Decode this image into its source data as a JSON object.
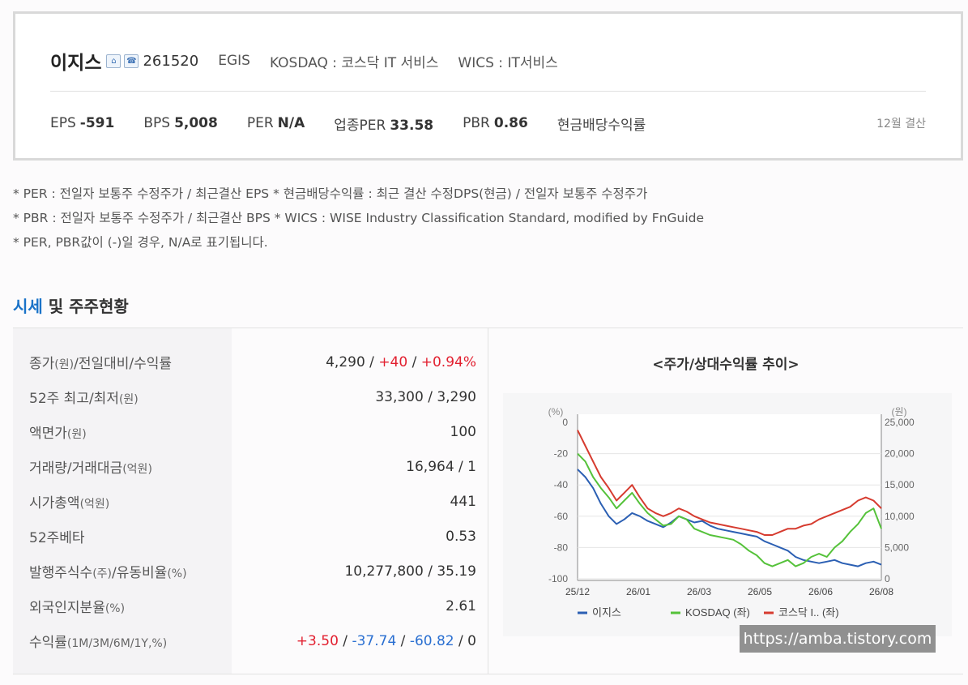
{
  "summary": {
    "company_name": "이지스",
    "home_icon": "home-icon",
    "phone_icon": "phone-icon",
    "code": "261520",
    "english_name": "EGIS",
    "market": "KOSDAQ : 코스닥 IT 서비스",
    "wics": "WICS : IT서비스",
    "indicators": [
      {
        "label": "EPS",
        "value": "-591"
      },
      {
        "label": "BPS",
        "value": "5,008"
      },
      {
        "label": "PER",
        "value": "N/A"
      },
      {
        "label": "업종PER",
        "value": "33.58"
      },
      {
        "label": "PBR",
        "value": "0.86"
      },
      {
        "label": "현금배당수익률",
        "value": ""
      }
    ],
    "settlement": "12월 결산"
  },
  "notes": [
    "* PER : 전일자 보통주 수정주가 / 최근결산 EPS * 현금배당수익률 : 최근 결산 수정DPS(현금) / 전일자 보통주 수정주가",
    "* PBR : 전일자 보통주 수정주가 / 최근결산 BPS * WICS : WISE Industry Classification Standard, modified by FnGuide",
    "* PER, PBR값이 (-)일 경우, N/A로 표기됩니다."
  ],
  "section": {
    "title_accent": "시세",
    "title_rest": " 및 주주현황"
  },
  "market": {
    "rows": [
      {
        "label": "종가",
        "unit": "(원)",
        "label2": "/전일대비/수익률",
        "value": "4,290",
        "sep1": " / ",
        "change": "+40",
        "sep2": " / ",
        "rate": "+0.94%"
      },
      {
        "label": "52주 최고/최저",
        "unit": "(원)",
        "value": "33,300 / 3,290"
      },
      {
        "label": "액면가",
        "unit": "(원)",
        "value": "100"
      },
      {
        "label": "거래량/거래대금",
        "unit": "(억원)",
        "value": "16,964 / 1"
      },
      {
        "label": "시가총액",
        "unit": "(억원)",
        "value": "441"
      },
      {
        "label": "52주베타",
        "unit": "",
        "value": "0.53"
      },
      {
        "label": "발행주식수",
        "unit": "(주)",
        "label2": "/유동비율",
        "unit2": "(%)",
        "value": "10,277,800 / 35.19"
      },
      {
        "label": "외국인지분율",
        "unit": "(%)",
        "value": "2.61"
      },
      {
        "label": "수익률",
        "unit": "(1M/3M/6M/1Y,%)",
        "r1": "+3.50",
        "r2": "-37.74",
        "r3": "-60.82",
        "r4": "0",
        "sep": " / "
      }
    ]
  },
  "chart_title": "<주가/상대수익률 추이>",
  "watermark": "https://amba.tistory.com",
  "chart_data": {
    "type": "line",
    "left_axis_unit": "(%)",
    "right_axis_unit": "(원)",
    "ylim_left": [
      -100,
      0
    ],
    "ylim_right": [
      0,
      25000
    ],
    "left_ticks": [
      "0",
      "-20",
      "-40",
      "-60",
      "-80",
      "-100"
    ],
    "right_ticks": [
      "25,000",
      "20,000",
      "15,000",
      "10,000",
      "5,000",
      "0"
    ],
    "x_ticks": [
      "25/12",
      "26/01",
      "26/03",
      "26/05",
      "26/06",
      "26/08"
    ],
    "grid": true,
    "legend_position": "bottom",
    "legend_entries": [
      "이지스",
      "KOSDAQ (좌)",
      "코스닥 I.. (좌)"
    ],
    "series": [
      {
        "name": "이지스",
        "axis": "left",
        "color": "#2b5fb3",
        "values": [
          -30,
          -35,
          -42,
          -52,
          -60,
          -65,
          -62,
          -58,
          -60,
          -63,
          -65,
          -67,
          -64,
          -60,
          -62,
          -64,
          -63,
          -66,
          -68,
          -69,
          -70,
          -71,
          -72,
          -73,
          -76,
          -78,
          -80,
          -82,
          -86,
          -88,
          -89,
          -90,
          -89,
          -88,
          -90,
          -91,
          -92,
          -90,
          -89,
          -91
        ]
      },
      {
        "name": "KOSDAQ (좌)",
        "axis": "left",
        "color": "#55c23a",
        "values": [
          -20,
          -25,
          -35,
          -42,
          -48,
          -55,
          -50,
          -45,
          -52,
          -58,
          -62,
          -66,
          -65,
          -60,
          -62,
          -68,
          -70,
          -72,
          -73,
          -74,
          -75,
          -78,
          -82,
          -85,
          -90,
          -92,
          -90,
          -88,
          -92,
          -90,
          -86,
          -84,
          -86,
          -80,
          -76,
          -70,
          -65,
          -58,
          -55,
          -68
        ]
      },
      {
        "name": "코스닥 I.. (좌)",
        "axis": "left",
        "color": "#d63b2f",
        "values": [
          -5,
          -15,
          -25,
          -35,
          -42,
          -50,
          -45,
          -40,
          -48,
          -55,
          -58,
          -60,
          -58,
          -55,
          -57,
          -60,
          -62,
          -64,
          -65,
          -66,
          -67,
          -68,
          -69,
          -70,
          -72,
          -72,
          -70,
          -68,
          -68,
          -66,
          -65,
          -62,
          -60,
          -58,
          -56,
          -54,
          -50,
          -48,
          -50,
          -55
        ]
      }
    ]
  }
}
